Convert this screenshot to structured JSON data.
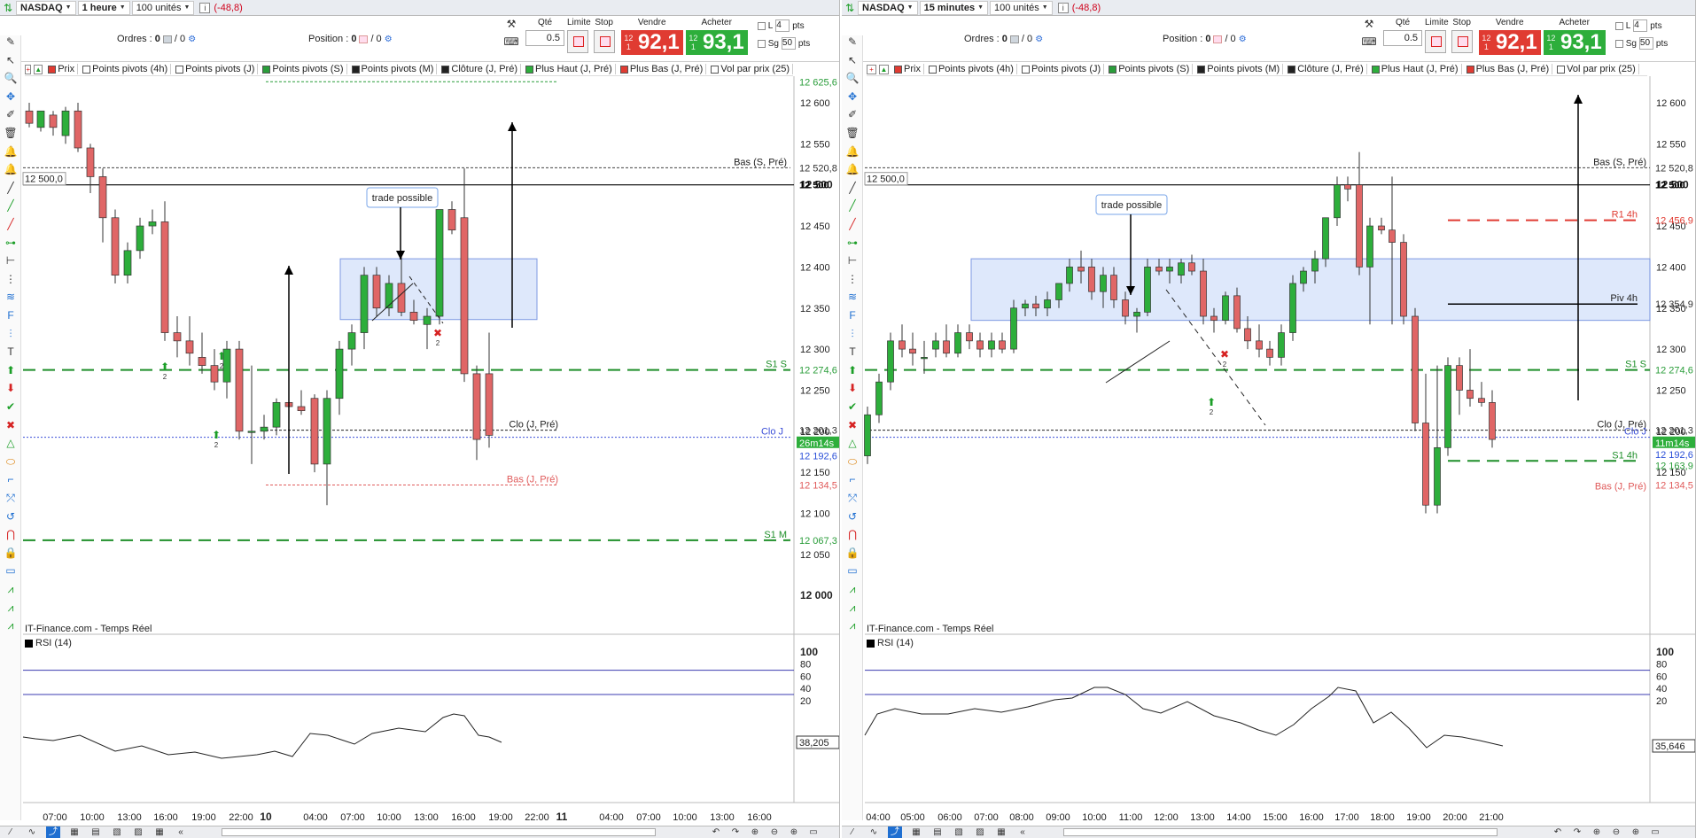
{
  "panels": [
    {
      "instrument": "NASDAQ",
      "timeframe": "1 heure",
      "units": "100 unités",
      "change": "(-48,8)",
      "orders_label": "Ordres :",
      "orders_a": "0",
      "orders_b": "/ 0",
      "position_label": "Position :",
      "position_a": "0",
      "position_b": "/ 0",
      "qty_label": "Qté",
      "qty_value": "0.5",
      "limit_label": "Limite",
      "stop_label": "Stop",
      "sell_label": "Vendre",
      "buy_label": "Acheter",
      "sell_prefix": "12 1",
      "sell_price": "92,1",
      "buy_prefix": "12 1",
      "buy_price": "93,1",
      "opt_l": "L",
      "opt_sg": "Sg",
      "pts_a": "4",
      "pts_b": "50",
      "pts_label": "pts",
      "legend": [
        "Prix",
        "Points pivots (4h)",
        "Points pivots (J)",
        "Points pivots (S)",
        "Points pivots (M)",
        "Clôture (J, Pré)",
        "Plus Haut (J, Pré)",
        "Plus Bas (J, Pré)",
        "Vol par prix (25)"
      ],
      "y_ticks": [
        "12 600",
        "12 550",
        "12 500",
        "12 450",
        "12 400",
        "12 350",
        "12 300",
        "12 250",
        "12 200",
        "12 150",
        "12 100",
        "12 050",
        "12 000"
      ],
      "price_tags": [
        {
          "text": "12 625,6",
          "color": "#2a9d3a"
        },
        {
          "text": "12 520,8",
          "color": "#333"
        },
        {
          "text": "12 500",
          "color": "#000"
        },
        {
          "text": "12 274,6",
          "color": "#2a9d3a"
        },
        {
          "text": "12 201,3",
          "color": "#333"
        },
        {
          "text": "26m14s",
          "color": "#fff"
        },
        {
          "text": "12 192,6",
          "color": "#2a4fd8"
        },
        {
          "text": "12 134,5",
          "color": "#e05b5b"
        },
        {
          "text": "12 067,3",
          "color": "#2a9d3a"
        }
      ],
      "line_labels": [
        "Bas (S, Pré)",
        "S1 S",
        "Clo (J, Pré)",
        "Clo J",
        "Bas (J, Pré)",
        "S1 M"
      ],
      "price_box": "12 500,0",
      "note": "trade possible",
      "signal_num": "2",
      "feed": "IT-Finance.com - Temps Réel",
      "rsi_label": "RSI (14)",
      "rsi_ticks": [
        "100",
        "80",
        "60",
        "40",
        "20"
      ],
      "rsi_value": "38,205",
      "x_ticks": [
        "07:00",
        "10:00",
        "13:00",
        "16:00",
        "19:00",
        "22:00",
        "10",
        "04:00",
        "07:00",
        "10:00",
        "13:00",
        "16:00",
        "19:00",
        "22:00",
        "11",
        "04:00",
        "07:00",
        "10:00",
        "13:00",
        "16:00"
      ]
    },
    {
      "instrument": "NASDAQ",
      "timeframe": "15 minutes",
      "units": "100 unités",
      "change": "(-48,8)",
      "orders_label": "Ordres :",
      "orders_a": "0",
      "orders_b": "/ 0",
      "position_label": "Position :",
      "position_a": "0",
      "position_b": "/ 0",
      "qty_label": "Qté",
      "qty_value": "0.5",
      "limit_label": "Limite",
      "stop_label": "Stop",
      "sell_label": "Vendre",
      "buy_label": "Acheter",
      "sell_prefix": "12 1",
      "sell_price": "92,1",
      "buy_prefix": "12 1",
      "buy_price": "93,1",
      "opt_l": "L",
      "opt_sg": "Sg",
      "pts_a": "4",
      "pts_b": "50",
      "pts_label": "pts",
      "legend": [
        "Prix",
        "Points pivots (4h)",
        "Points pivots (J)",
        "Points pivots (S)",
        "Points pivots (M)",
        "Clôture (J, Pré)",
        "Plus Haut (J, Pré)",
        "Plus Bas (J, Pré)",
        "Vol par prix (25)"
      ],
      "y_ticks": [
        "12 600",
        "12 550",
        "12 500",
        "12 450",
        "12 400",
        "12 350",
        "12 300",
        "12 250",
        "12 200",
        "12 150"
      ],
      "price_tags": [
        {
          "text": "12 520,8",
          "color": "#333"
        },
        {
          "text": "12 500",
          "color": "#000"
        },
        {
          "text": "12 456,9",
          "color": "#e03b32"
        },
        {
          "text": "12 354,9",
          "color": "#333"
        },
        {
          "text": "12 274,6",
          "color": "#2a9d3a"
        },
        {
          "text": "12 201,3",
          "color": "#333"
        },
        {
          "text": "11m14s",
          "color": "#fff"
        },
        {
          "text": "12 192,6",
          "color": "#2a4fd8"
        },
        {
          "text": "12 163,9",
          "color": "#2a9d3a"
        },
        {
          "text": "12 134,5",
          "color": "#e05b5b"
        }
      ],
      "line_labels": [
        "Bas (S, Pré)",
        "R1 4h",
        "Piv 4h",
        "S1 S",
        "Clo (J, Pré)",
        "Clo J",
        "S1 4h",
        "Bas (J, Pré)"
      ],
      "price_box": "12 500,0",
      "note": "trade possible",
      "signal_num": "2",
      "feed": "IT-Finance.com - Temps Réel",
      "rsi_label": "RSI (14)",
      "rsi_ticks": [
        "100",
        "80",
        "60",
        "40",
        "20"
      ],
      "rsi_value": "35,646",
      "x_ticks": [
        "04:00",
        "05:00",
        "06:00",
        "07:00",
        "08:00",
        "09:00",
        "10:00",
        "11:00",
        "12:00",
        "13:00",
        "14:00",
        "15:00",
        "16:00",
        "17:00",
        "18:00",
        "19:00",
        "20:00",
        "21:00"
      ]
    }
  ],
  "colors": {
    "bull": "#2dae3b",
    "bear": "#e06666",
    "box": "#dbe6fb",
    "sell": "#e03b32",
    "buy": "#2dae3b",
    "s1": "#1f8f2a"
  },
  "icons": [
    "pencil-icon",
    "cursor-icon",
    "zoom-icon",
    "move-icon",
    "eraser-icon",
    "trash-icon",
    "alert-icon",
    "line-icon",
    "fib-icon",
    "text-icon",
    "arrow-up-icon",
    "arrow-down-icon",
    "check-icon",
    "cross-icon",
    "triangle-icon",
    "magnet-icon"
  ]
}
